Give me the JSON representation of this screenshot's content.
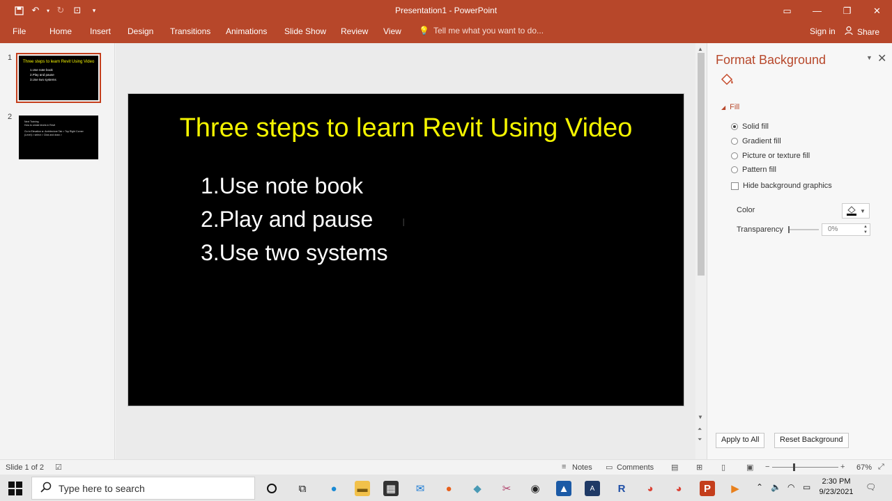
{
  "window": {
    "title": "Presentation1 - PowerPoint",
    "accent_color": "#b7472a"
  },
  "ribbon": {
    "tabs": [
      "File",
      "Home",
      "Insert",
      "Design",
      "Transitions",
      "Animations",
      "Slide Show",
      "Review",
      "View"
    ],
    "tell_me": "Tell me what you want to do...",
    "sign_in": "Sign in",
    "share": "Share"
  },
  "thumbnails": [
    {
      "number": "1",
      "title": "Three steps to learn Revit Using Video",
      "lines": [
        "1.Use note book",
        "2.Play and pause",
        "3.Use two systems"
      ]
    },
    {
      "number": "2",
      "lines": [
        "Next Training",
        "How to create levels in Revit",
        "Go to Elevation ► Architecture Tab > Top Right Corner",
        "(Level) > select > Click and draw >"
      ]
    }
  ],
  "slide": {
    "title": "Three steps to learn Revit Using Video",
    "bullets": [
      "1.Use note book",
      "2.Play and pause",
      "3.Use two systems"
    ],
    "background_color": "#000000",
    "title_color": "#f4f400",
    "body_color": "#ffffff"
  },
  "format_pane": {
    "title": "Format Background",
    "section": "Fill",
    "options": [
      "Solid fill",
      "Gradient fill",
      "Picture or texture fill",
      "Pattern fill"
    ],
    "selected_option": "Solid fill",
    "hide_graphics": "Hide background graphics",
    "color_label": "Color",
    "transparency_label": "Transparency",
    "transparency_value": "0%",
    "apply_all": "Apply to All",
    "reset": "Reset Background"
  },
  "status": {
    "slide_info": "Slide 1 of 2",
    "notes": "Notes",
    "comments": "Comments",
    "zoom": "67%"
  },
  "taskbar": {
    "search_placeholder": "Type here to search",
    "time": "2:30 PM",
    "date": "9/23/2021"
  }
}
